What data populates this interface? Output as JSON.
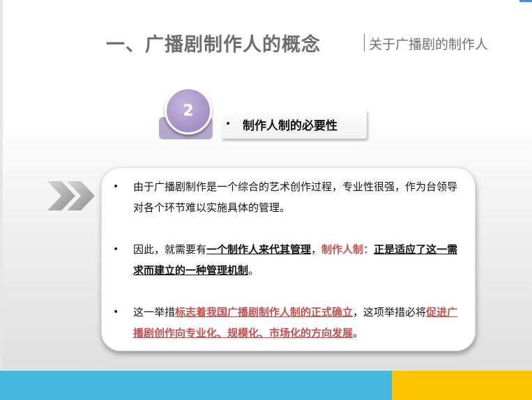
{
  "header": {
    "title": "一、广播剧制作人的概念",
    "subtitle": "关于广播剧的制作人"
  },
  "section": {
    "number": "2",
    "bullet": "•",
    "heading": "制作人制的必要性"
  },
  "content": {
    "bullet": "•",
    "items": [
      {
        "parts": [
          "由于广播剧制作是一个综合的艺术创作过程，专业性很强，作为台领导对各个环节难以实施具体的管理。"
        ]
      },
      {
        "parts": [
          "因此，就需要有",
          "一个制作人来代其管理",
          "，",
          "制作人制：",
          "正是适应了这一需求而建立的一种管理机制",
          "。"
        ]
      },
      {
        "parts": [
          "这一举措",
          "标志着我国广播剧制作人制的正式确立",
          "，这项举措必将",
          "促进广播剧创作向专业化、规模化、市场化的方向发展",
          "。"
        ]
      }
    ]
  },
  "colors": {
    "accent_purple": "#a28fc4",
    "accent_red": "#c0504d",
    "footer_blue": "#46b8dc",
    "footer_yellow": "#fdc500"
  },
  "icons": {
    "chevrons": "double-chevron-right-icon"
  }
}
